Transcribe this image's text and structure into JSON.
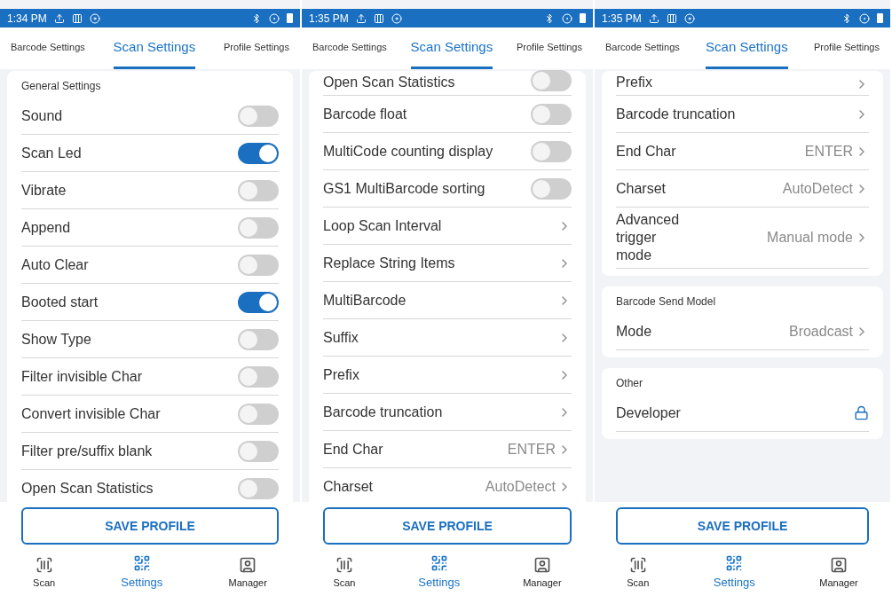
{
  "screens": [
    {
      "status_time": "1:34 PM",
      "tabs": [
        {
          "label": "Barcode Settings",
          "selected": false
        },
        {
          "label": "Scan Settings",
          "selected": true
        },
        {
          "label": "Profile Settings",
          "selected": false
        }
      ],
      "sections": [
        {
          "title": "General Settings",
          "rows": [
            {
              "kind": "toggle",
              "label": "Sound",
              "on": false
            },
            {
              "kind": "toggle",
              "label": "Scan Led",
              "on": true
            },
            {
              "kind": "toggle",
              "label": "Vibrate",
              "on": false
            },
            {
              "kind": "toggle",
              "label": "Append",
              "on": false
            },
            {
              "kind": "toggle",
              "label": "Auto Clear",
              "on": false
            },
            {
              "kind": "toggle",
              "label": "Booted start",
              "on": true
            },
            {
              "kind": "toggle",
              "label": "Show Type",
              "on": false
            },
            {
              "kind": "toggle",
              "label": "Filter invisible Char",
              "on": false
            },
            {
              "kind": "toggle",
              "label": "Convert invisible Char",
              "on": false
            },
            {
              "kind": "toggle",
              "label": "Filter pre/suffix blank",
              "on": false
            },
            {
              "kind": "toggle",
              "label": "Open Scan Statistics",
              "on": false
            }
          ]
        }
      ],
      "save_button": "SAVE PROFILE",
      "nav": [
        {
          "label": "Scan",
          "selected": false
        },
        {
          "label": "Settings",
          "selected": true
        },
        {
          "label": "Manager",
          "selected": false
        }
      ]
    },
    {
      "status_time": "1:35 PM",
      "tabs": [
        {
          "label": "Barcode Settings",
          "selected": false
        },
        {
          "label": "Scan Settings",
          "selected": true
        },
        {
          "label": "Profile Settings",
          "selected": false
        }
      ],
      "sections": [
        {
          "rows": [
            {
              "kind": "toggle",
              "label": "Open Scan Statistics",
              "on": false,
              "partial": true
            },
            {
              "kind": "toggle",
              "label": "Barcode float",
              "on": false
            },
            {
              "kind": "toggle",
              "label": "MultiCode counting display",
              "on": false
            },
            {
              "kind": "toggle",
              "label": "GS1 MultiBarcode sorting",
              "on": false
            },
            {
              "kind": "link",
              "label": "Loop Scan Interval"
            },
            {
              "kind": "link",
              "label": "Replace String Items"
            },
            {
              "kind": "link",
              "label": "MultiBarcode"
            },
            {
              "kind": "link",
              "label": "Suffix"
            },
            {
              "kind": "link",
              "label": "Prefix"
            },
            {
              "kind": "link",
              "label": "Barcode truncation"
            },
            {
              "kind": "link",
              "label": "End Char",
              "value": "ENTER"
            },
            {
              "kind": "link",
              "label": "Charset",
              "value": "AutoDetect"
            }
          ]
        }
      ],
      "save_button": "SAVE PROFILE",
      "nav": [
        {
          "label": "Scan",
          "selected": false
        },
        {
          "label": "Settings",
          "selected": true
        },
        {
          "label": "Manager",
          "selected": false
        }
      ]
    },
    {
      "status_time": "1:35 PM",
      "tabs": [
        {
          "label": "Barcode Settings",
          "selected": false
        },
        {
          "label": "Scan Settings",
          "selected": true
        },
        {
          "label": "Profile Settings",
          "selected": false
        }
      ],
      "sections": [
        {
          "rows": [
            {
              "kind": "link",
              "label": "Prefix",
              "partial": true
            },
            {
              "kind": "link",
              "label": "Barcode truncation"
            },
            {
              "kind": "link",
              "label": "End Char",
              "value": "ENTER"
            },
            {
              "kind": "link",
              "label": "Charset",
              "value": "AutoDetect"
            },
            {
              "kind": "link",
              "label": "Advanced trigger mode",
              "value": "Manual mode"
            }
          ]
        },
        {
          "title": "Barcode Send Model",
          "rows": [
            {
              "kind": "link",
              "label": "Mode",
              "value": "Broadcast"
            }
          ]
        },
        {
          "title": "Other",
          "rows": [
            {
              "kind": "lock",
              "label": "Developer"
            }
          ]
        }
      ],
      "save_button": "SAVE PROFILE",
      "nav": [
        {
          "label": "Scan",
          "selected": false
        },
        {
          "label": "Settings",
          "selected": true
        },
        {
          "label": "Manager",
          "selected": false
        }
      ]
    }
  ]
}
